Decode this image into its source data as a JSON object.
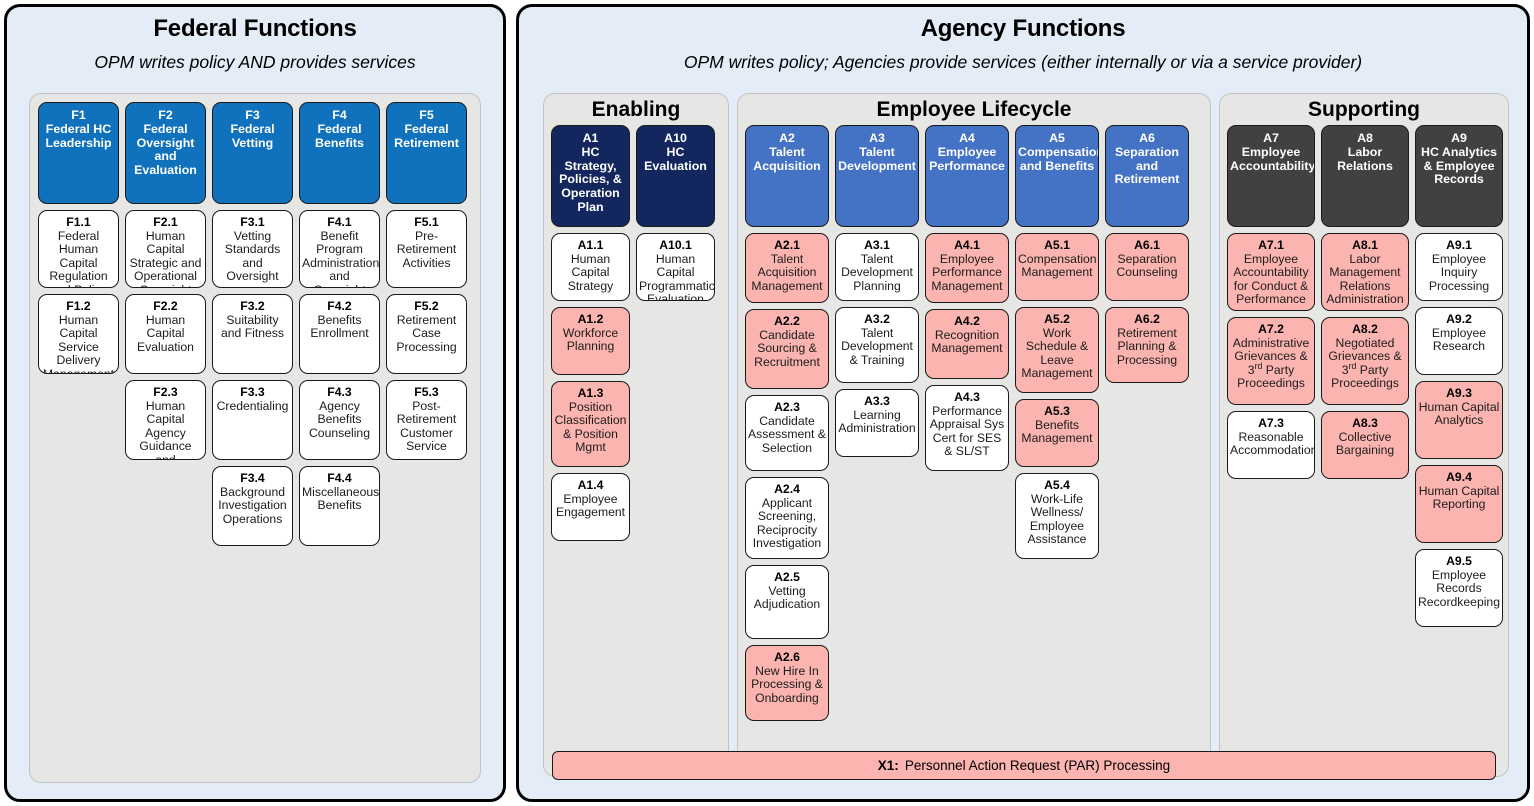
{
  "colors": {
    "outer_panel_bg": "#e3ecf7",
    "group_bg": "#e6e6e4",
    "federal_header": "#1072bc",
    "lifecycle_header": "#4472c4",
    "enabling_header": "#13275e",
    "supporting_header": "#414141",
    "highlight_pink": "#fbb4b0",
    "plain_white": "#ffffff"
  },
  "federal": {
    "title": "Federal Functions",
    "subtitle": "OPM writes policy AND provides services",
    "columns": [
      {
        "header": {
          "code": "F1",
          "name": "Federal HC Leadership",
          "style": "blue"
        },
        "items": [
          {
            "code": "F1.1",
            "name": "Federal Human Capital Regulation and Policy",
            "style": "white"
          },
          {
            "code": "F1.2",
            "name": "Human Capital Service Delivery Management",
            "style": "white"
          }
        ]
      },
      {
        "header": {
          "code": "F2",
          "name": "Federal Oversight and Evaluation",
          "style": "blue"
        },
        "items": [
          {
            "code": "F2.1",
            "name": "Human Capital Strategic and Operational Oversight",
            "style": "white"
          },
          {
            "code": "F2.2",
            "name": "Human Capital Evaluation",
            "style": "white"
          },
          {
            "code": "F2.3",
            "name": "Human Capital Agency Guidance and Evaluation",
            "style": "white"
          }
        ]
      },
      {
        "header": {
          "code": "F3",
          "name": "Federal Vetting",
          "style": "blue"
        },
        "items": [
          {
            "code": "F3.1",
            "name": "Vetting Standards and Oversight",
            "style": "white"
          },
          {
            "code": "F3.2",
            "name": "Suitability and Fitness",
            "style": "white"
          },
          {
            "code": "F3.3",
            "name": "Credentialing",
            "style": "white"
          },
          {
            "code": "F3.4",
            "name": "Background Investigation Operations",
            "style": "white"
          }
        ]
      },
      {
        "header": {
          "code": "F4",
          "name": "Federal Benefits",
          "style": "blue"
        },
        "items": [
          {
            "code": "F4.1",
            "name": "Benefit Program Administration and Oversight",
            "style": "white"
          },
          {
            "code": "F4.2",
            "name": "Benefits Enrollment",
            "style": "white"
          },
          {
            "code": "F4.3",
            "name": "Agency Benefits Counseling",
            "style": "white"
          },
          {
            "code": "F4.4",
            "name": "Miscellaneous Benefits",
            "style": "white"
          }
        ]
      },
      {
        "header": {
          "code": "F5",
          "name": "Federal Retirement",
          "style": "blue"
        },
        "items": [
          {
            "code": "F5.1",
            "name": "Pre-Retirement Activities",
            "style": "white"
          },
          {
            "code": "F5.2",
            "name": "Retirement Case Processing",
            "style": "white"
          },
          {
            "code": "F5.3",
            "name": "Post-Retirement Customer Service",
            "style": "white"
          }
        ]
      }
    ]
  },
  "agency": {
    "title": "Agency Functions",
    "subtitle": "OPM writes policy; Agencies provide services (either internally or via a service provider)",
    "groups": [
      {
        "title": "Enabling",
        "columns": [
          {
            "header": {
              "code": "A1",
              "name": "HC Strategy, Policies, & Operation Plan",
              "style": "navy"
            },
            "items": [
              {
                "code": "A1.1",
                "name": "Human Capital Strategy",
                "style": "white"
              },
              {
                "code": "A1.2",
                "name": "Workforce Planning",
                "style": "pink"
              },
              {
                "code": "A1.3",
                "name": "Position Classification & Position Mgmt",
                "style": "pink"
              },
              {
                "code": "A1.4",
                "name": "Employee Engagement",
                "style": "white"
              }
            ]
          },
          {
            "header": {
              "code": "A10",
              "name": "HC Evaluation",
              "style": "navy"
            },
            "items": [
              {
                "code": "A10.1",
                "name": "Human Capital Programmatic Evaluation",
                "style": "white"
              }
            ]
          }
        ]
      },
      {
        "title": "Employee Lifecycle",
        "columns": [
          {
            "header": {
              "code": "A2",
              "name": "Talent Acquisition",
              "style": "royal"
            },
            "items": [
              {
                "code": "A2.1",
                "name": "Talent Acquisition Management",
                "style": "pink"
              },
              {
                "code": "A2.2",
                "name": "Candidate Sourcing & Recruitment",
                "style": "pink"
              },
              {
                "code": "A2.3",
                "name": "Candidate Assessment & Selection",
                "style": "white"
              },
              {
                "code": "A2.4",
                "name": "Applicant Screening, Reciprocity Investigation",
                "style": "white"
              },
              {
                "code": "A2.5",
                "name": "Vetting Adjudication",
                "style": "white"
              },
              {
                "code": "A2.6",
                "name": "New Hire In Processing & Onboarding",
                "style": "pink"
              }
            ]
          },
          {
            "header": {
              "code": "A3",
              "name": "Talent Development",
              "style": "royal"
            },
            "items": [
              {
                "code": "A3.1",
                "name": "Talent Development Planning",
                "style": "white"
              },
              {
                "code": "A3.2",
                "name": "Talent Development & Training",
                "style": "white"
              },
              {
                "code": "A3.3",
                "name": "Learning Administration",
                "style": "white"
              }
            ]
          },
          {
            "header": {
              "code": "A4",
              "name": "Employee Performance",
              "style": "royal"
            },
            "items": [
              {
                "code": "A4.1",
                "name": "Employee Performance Management",
                "style": "pink"
              },
              {
                "code": "A4.2",
                "name": "Recognition Management",
                "style": "pink"
              },
              {
                "code": "A4.3",
                "name": "Performance Appraisal Sys Cert for SES & SL/ST",
                "style": "white"
              }
            ]
          },
          {
            "header": {
              "code": "A5",
              "name": "Compensation and Benefits",
              "style": "royal"
            },
            "items": [
              {
                "code": "A5.1",
                "name": "Compensation Management",
                "style": "pink"
              },
              {
                "code": "A5.2",
                "name": "Work Schedule & Leave Management",
                "style": "pink"
              },
              {
                "code": "A5.3",
                "name": "Benefits Management",
                "style": "pink"
              },
              {
                "code": "A5.4",
                "name": "Work-Life Wellness/ Employee Assistance",
                "style": "white"
              }
            ]
          },
          {
            "header": {
              "code": "A6",
              "name": "Separation and Retirement",
              "style": "royal"
            },
            "items": [
              {
                "code": "A6.1",
                "name": "Separation Counseling",
                "style": "pink"
              },
              {
                "code": "A6.2",
                "name": "Retirement Planning & Processing",
                "style": "pink"
              }
            ]
          }
        ]
      },
      {
        "title": "Supporting",
        "columns": [
          {
            "header": {
              "code": "A7",
              "name": "Employee Accountability",
              "style": "dark"
            },
            "items": [
              {
                "code": "A7.1",
                "name": "Employee Accountability for Conduct & Performance",
                "style": "pink"
              },
              {
                "code": "A7.2",
                "name": "Administrative Grievances & 3rd Party Proceedings",
                "style": "pink",
                "sup": "rd"
              },
              {
                "code": "A7.3",
                "name": "Reasonable Accommodation",
                "style": "white"
              }
            ]
          },
          {
            "header": {
              "code": "A8",
              "name": "Labor Relations",
              "style": "dark"
            },
            "items": [
              {
                "code": "A8.1",
                "name": "Labor Management Relations Administration",
                "style": "pink"
              },
              {
                "code": "A8.2",
                "name": "Negotiated Grievances & 3rd Party Proceedings",
                "style": "pink",
                "sup": "rd"
              },
              {
                "code": "A8.3",
                "name": "Collective Bargaining",
                "style": "pink"
              }
            ]
          },
          {
            "header": {
              "code": "A9",
              "name": "HC Analytics & Employee Records",
              "style": "dark"
            },
            "items": [
              {
                "code": "A9.1",
                "name": "Employee Inquiry Processing",
                "style": "white"
              },
              {
                "code": "A9.2",
                "name": "Employee Research",
                "style": "white"
              },
              {
                "code": "A9.3",
                "name": "Human Capital Analytics",
                "style": "pink"
              },
              {
                "code": "A9.4",
                "name": "Human Capital Reporting",
                "style": "pink"
              },
              {
                "code": "A9.5",
                "name": "Employee Records Recordkeeping",
                "style": "white"
              }
            ]
          }
        ]
      }
    ],
    "cross_cutting_bar": {
      "code": "X1:",
      "name": "Personnel Action Request (PAR) Processing"
    }
  }
}
